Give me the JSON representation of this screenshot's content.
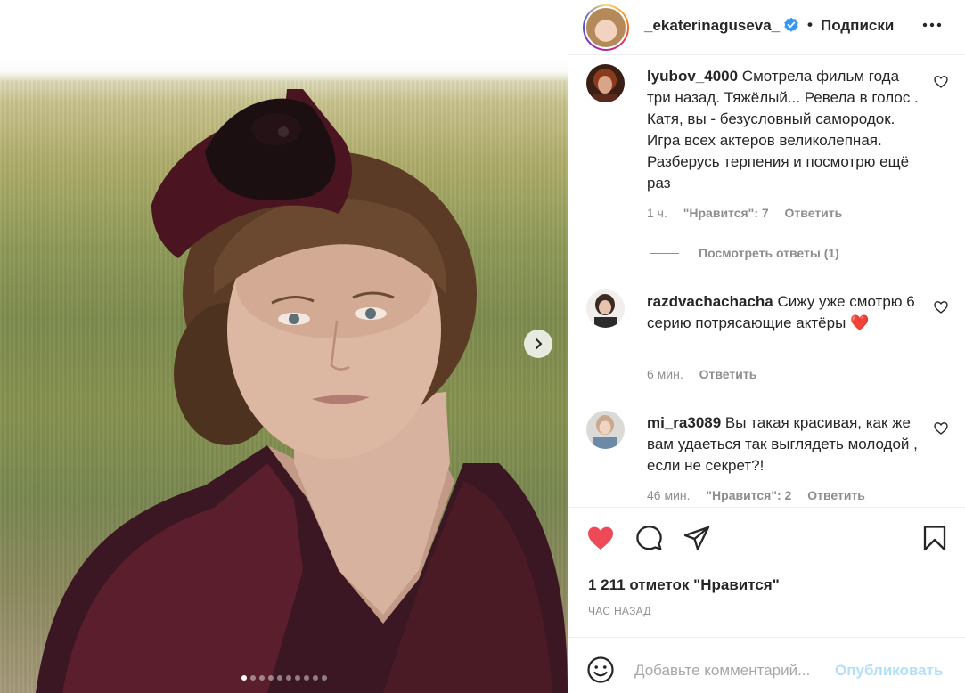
{
  "post": {
    "slide_count": 10,
    "active_slide": 1
  },
  "header": {
    "username": "_ekaterinaguseva_",
    "separator": "•",
    "follow_label": "Подписки",
    "verified_color": "#3897f0"
  },
  "comments": [
    {
      "username": "lyubov_4000",
      "text": "Смотрела фильм года три назад. Тяжёлый... Ревела в голос . Катя, вы - безусловный самородок. Игра всех актеров великолепная. Разберусь терпения и посмотрю ещё раз",
      "time": "1 ч.",
      "likes": "\"Нравится\": 7",
      "reply": "Ответить"
    },
    {
      "username": "razdvachachacha",
      "text": "Сижу уже смотрю 6 серию потрясающие актёры",
      "emoji": "❤️",
      "time": "6 мин.",
      "reply": "Ответить"
    },
    {
      "username": "mi_ra3089",
      "text": "Вы такая красивая, как же вам удаеться так выглядеть молодой , если не секрет?!",
      "time": "46 мин.",
      "likes": "\"Нравится\": 2",
      "reply": "Ответить"
    }
  ],
  "view_replies": "Посмотреть ответы (1)",
  "actions": {
    "liked": true,
    "like_color": "#ed4956",
    "likes_text": "1 211 отметок \"Нравится\"",
    "posted": "ЧАС НАЗАД"
  },
  "composer": {
    "placeholder": "Добавьте комментарий...",
    "publish_label": "Опубликовать",
    "publish_color": "#b2dffc"
  }
}
